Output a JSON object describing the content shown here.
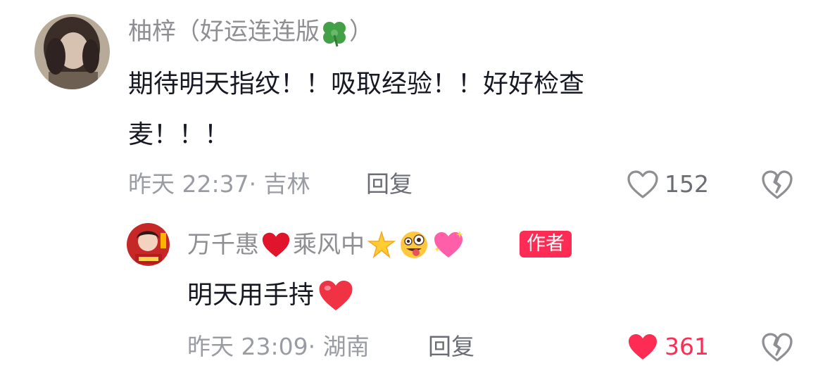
{
  "comments": [
    {
      "username": "柚梓（好运连连版",
      "username_suffix": "）",
      "text_line1": "期待明天指纹！！吸取经验！！好好检查",
      "text_line2": "麦！！！",
      "meta": "昨天 22:37· 吉林",
      "reply_label": "回复",
      "likes": "152",
      "liked": false
    },
    {
      "username": "万千惠",
      "username_mid": "乘风中",
      "author_badge": "作者",
      "text": "明天用手持",
      "meta": "昨天 23:09· 湖南",
      "reply_label": "回复",
      "likes": "361",
      "liked": true
    }
  ],
  "colors": {
    "accent": "#fe2c55",
    "secondary_text": "#8e8e93",
    "primary_text": "#161823"
  },
  "icons": [
    "clover-emoji",
    "red-heart-emoji",
    "sparkle-star-emoji",
    "zany-face-emoji",
    "sparkling-heart-emoji",
    "like-heart-icon",
    "dislike-broken-heart-icon"
  ]
}
